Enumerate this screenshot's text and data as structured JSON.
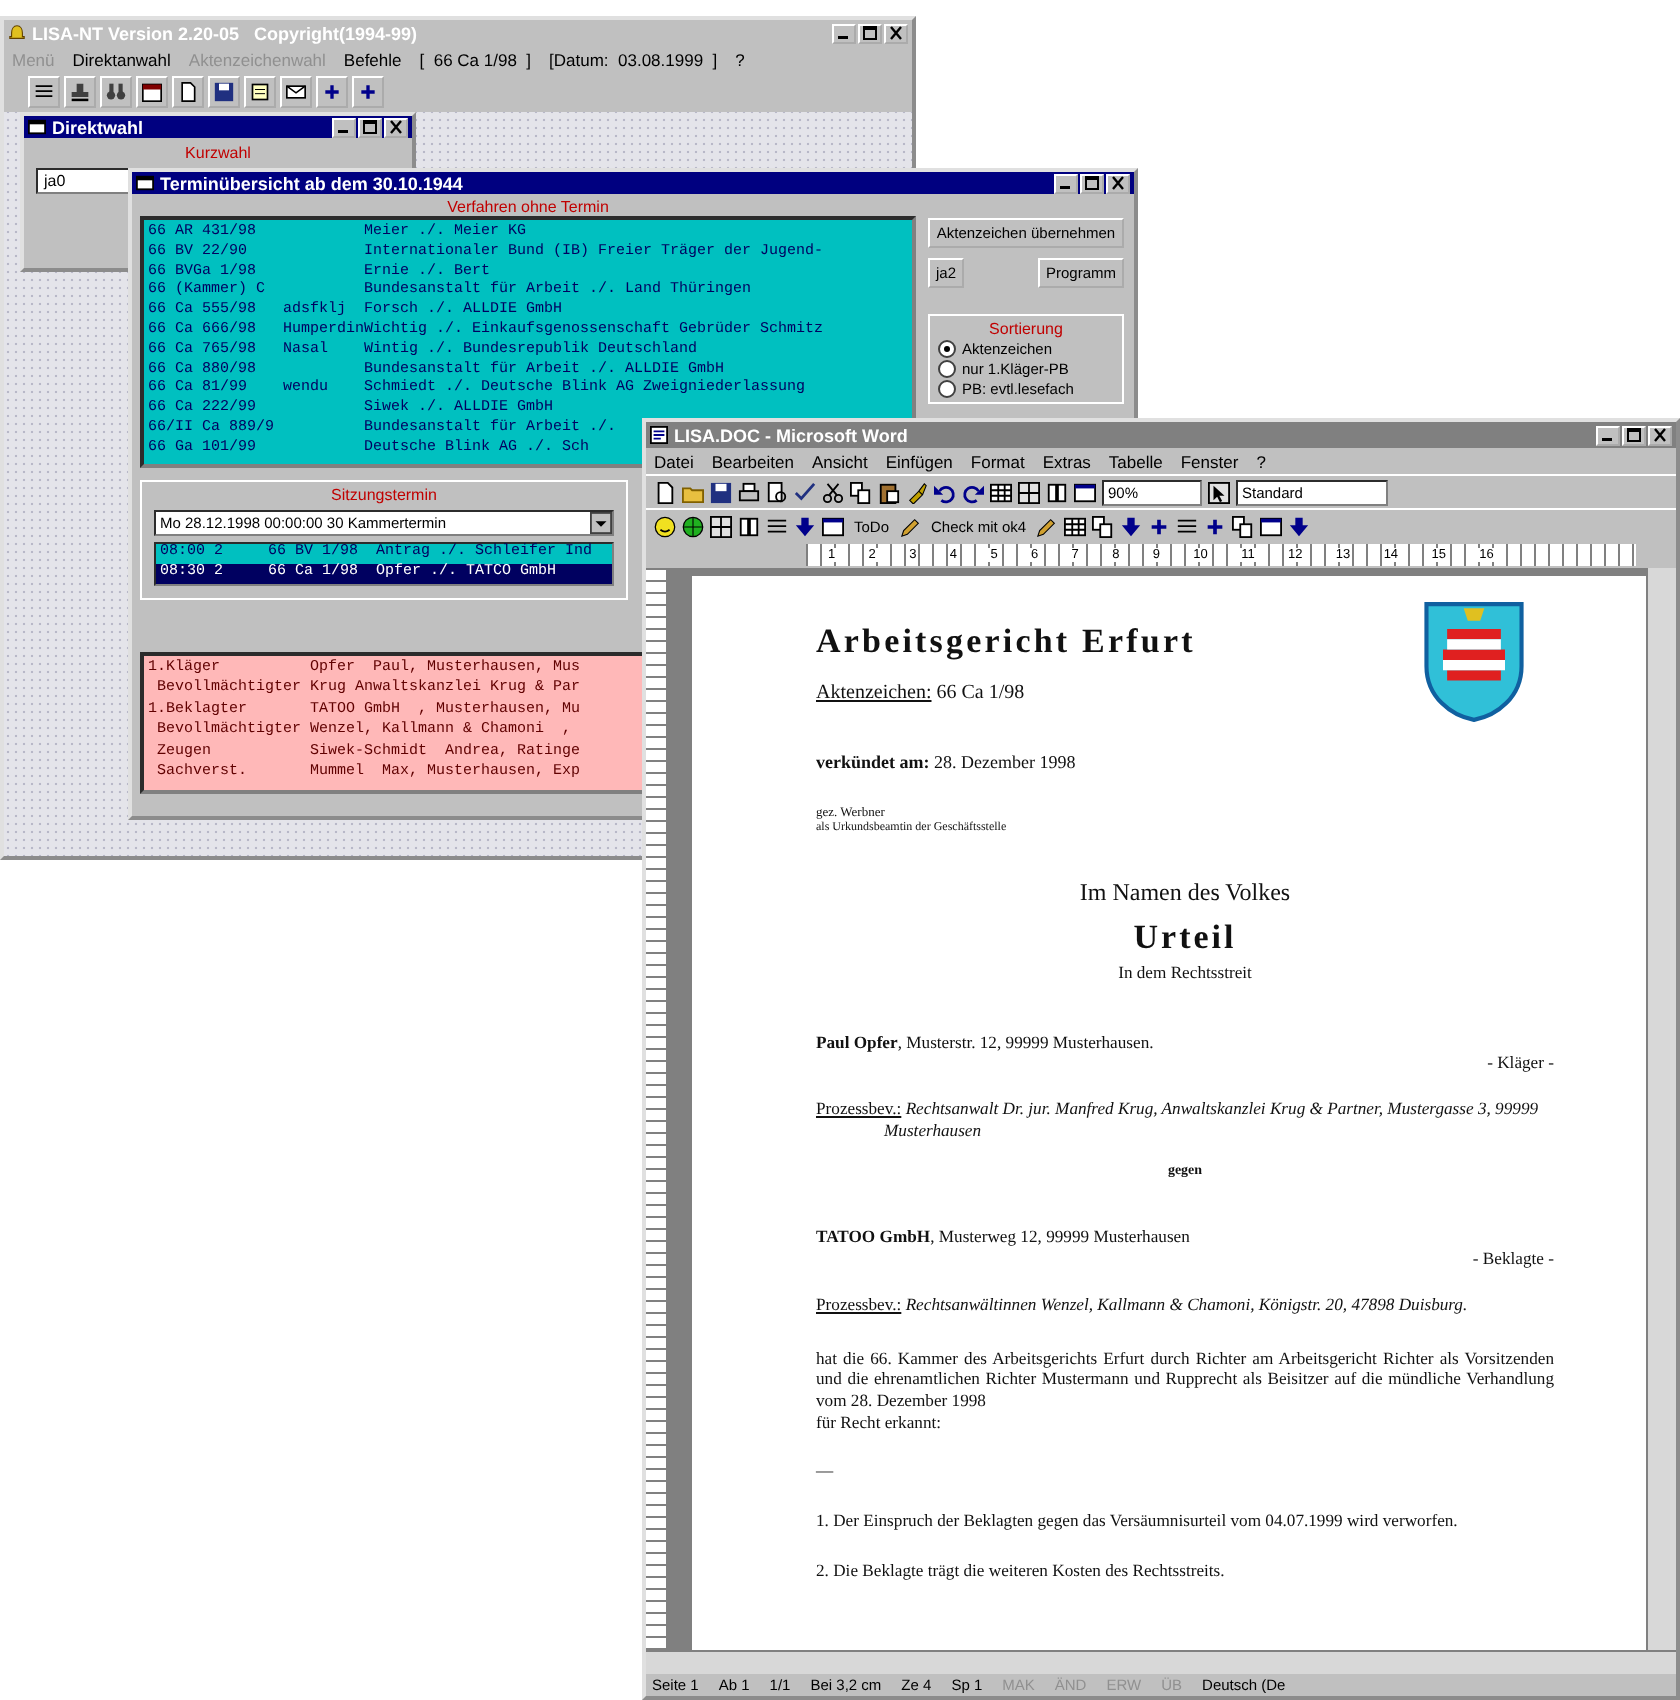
{
  "main_window": {
    "title": "LISA-NT Version 2.20-05   Copyright(1994-99)",
    "menu": [
      {
        "label": "Menü",
        "disabled": true
      },
      {
        "label": "Direktanwahl",
        "disabled": false
      },
      {
        "label": "Aktenzeichenwahl",
        "disabled": true
      },
      {
        "label": "Befehle",
        "disabled": false
      },
      {
        "label": "[  66 Ca 1/98  ]",
        "disabled": false
      },
      {
        "label": "[Datum:  03.08.1999  ]",
        "disabled": false
      },
      {
        "label": "?",
        "disabled": false
      }
    ]
  },
  "direktwahl_window": {
    "title": "Direktwahl",
    "group_label": "Kurzwahl",
    "field_value": "ja0"
  },
  "termin_window": {
    "title": "Terminübersicht ab dem 30.10.1944",
    "unscheduled_label": "Verfahren ohne Termin",
    "unscheduled_rows": [
      {
        "file": "66 AR 431/98",
        "note": "",
        "parties": "Meier ./. Meier KG"
      },
      {
        "file": "66 BV 22/90",
        "note": "",
        "parties": "Internationaler Bund (IB) Freier Träger der Jugend-"
      },
      {
        "file": "66 BVGa 1/98",
        "note": "",
        "parties": "Ernie ./. Bert"
      },
      {
        "file": "66 (Kammer) C",
        "note": "",
        "parties": "Bundesanstalt für Arbeit ./. Land Thüringen"
      },
      {
        "file": "66 Ca 555/98",
        "note": "adsfklj",
        "parties": "Forsch ./. ALLDIE GmbH"
      },
      {
        "file": "66 Ca 666/98",
        "note": "Humperdin",
        "parties": "Wichtig ./. Einkaufsgenossenschaft Gebrüder Schmitz"
      },
      {
        "file": "66 Ca 765/98",
        "note": "Nasal",
        "parties": "Wintig ./. Bundesrepublik Deutschland"
      },
      {
        "file": "66 Ca 880/98",
        "note": "",
        "parties": "Bundesanstalt für Arbeit ./. ALLDIE GmbH"
      },
      {
        "file": "66 Ca 81/99",
        "note": "wendu",
        "parties": "Schmiedt ./. Deutsche Blink AG Zweigniederlassung"
      },
      {
        "file": "66 Ca 222/99",
        "note": "",
        "parties": "Siwek ./. ALLDIE GmbH"
      },
      {
        "file": "66/II Ca 889/9",
        "note": "",
        "parties": "Bundesanstalt für Arbeit ./."
      },
      {
        "file": "66 Ga 101/99",
        "note": "",
        "parties": "Deutsche Blink AG ./. Sch"
      }
    ],
    "buttons": [
      "Aktenzeichen übernehmen",
      "ja2",
      "Programm"
    ],
    "sort_label": "Sortierung",
    "sort_options": [
      {
        "label": "Aktenzeichen",
        "selected": true
      },
      {
        "label": "nur 1.Kläger-PB",
        "selected": false
      },
      {
        "label": "PB: evtl.lesefach",
        "selected": false
      }
    ],
    "session_label": "Sitzungstermin",
    "session_select": "Mo 28.12.1998 00:00:00 30 Kammertermin",
    "sessions": [
      {
        "time": "08:00 2",
        "file": "66 BV 1/98",
        "parties": "Antrag ./. Schleifer Ind",
        "selected": false
      },
      {
        "time": "08:30 2",
        "file": "66 Ca 1/98",
        "parties": "Opfer ./. TATCO GmbH",
        "selected": true
      }
    ],
    "participants": [
      {
        "role": "1.Kläger",
        "details": "Opfer  Paul, Musterhausen, Mus"
      },
      {
        "role": " Bevollmächtigter",
        "details": "Krug Anwaltskanzlei Krug & Par"
      },
      {
        "role": "1.Beklagter",
        "details": "TATOO GmbH  , Musterhausen, Mu"
      },
      {
        "role": " Bevollmächtigter",
        "details": "Wenzel, Kallmann & Chamoni  ,"
      },
      {
        "role": " Zeugen",
        "details": "Siwek-Schmidt  Andrea, Ratinge"
      },
      {
        "role": " Sachverst.",
        "details": "Mummel  Max, Musterhausen, Exp"
      }
    ]
  },
  "word_window": {
    "title": "LISA.DOC - Microsoft Word",
    "menu": [
      "Datei",
      "Bearbeiten",
      "Ansicht",
      "Einfügen",
      "Format",
      "Extras",
      "Tabelle",
      "Fenster",
      "?"
    ],
    "zoom_value": "90%",
    "style_value": "Standard",
    "macro_buttons": [
      "ToDo",
      "Check mit ok4"
    ],
    "ruler_numbers": [
      "1",
      "2",
      "3",
      "4",
      "5",
      "6",
      "7",
      "8",
      "9",
      "10",
      "11",
      "12",
      "13",
      "14",
      "15",
      "16"
    ],
    "document": [
      {
        "kind": "title",
        "text": "Arbeitsgericht Erfurt"
      },
      {
        "kind": "ref",
        "label": "Aktenzeichen:",
        "text": "66 Ca 1/98"
      },
      {
        "kind": "date",
        "text": "**verkündet am:** 28. Dezember 1998"
      },
      {
        "kind": "signature",
        "text": "gez. Werbner"
      },
      {
        "kind": "small",
        "text": "als Urkundsbeamtin der Geschäftsstelle"
      },
      {
        "kind": "center",
        "text": "Im Namen des Volkes"
      },
      {
        "kind": "heading",
        "text": "Urteil"
      },
      {
        "kind": "subcenter",
        "text": "In dem Rechtsstreit"
      },
      {
        "kind": "party",
        "text": "**Paul Opfer**, Musterstr. 12, 99999 Musterhausen."
      },
      {
        "kind": "role",
        "text": "- Kläger -"
      },
      {
        "kind": "counsel",
        "label": "Prozessbev.:",
        "text": "Rechtsanwalt Dr. jur. Manfred Krug, Anwaltskanzlei Krug & Partner, Mustergasse 3, 99999 Musterhausen"
      },
      {
        "kind": "against",
        "text": "gegen"
      },
      {
        "kind": "party",
        "text": "**TATOO GmbH**, Musterweg 12, 99999 Musterhausen"
      },
      {
        "kind": "role",
        "text": "- Beklagte -"
      },
      {
        "kind": "counsel",
        "label": "Prozessbev.:",
        "text": "Rechtsanwältinnen Wenzel, Kallmann & Chamoni, Königstr. 20, 47898 Duisburg."
      },
      {
        "kind": "para",
        "text": "hat die 66. Kammer des Arbeitsgerichts Erfurt durch Richter am Arbeitsgericht Richter als Vorsitzenden und die ehrenamtlichen Richter Mustermann und Rupprecht als Beisitzer auf die mündliche Verhandlung vom 28. Dezember 1998"
      },
      {
        "kind": "plain",
        "text": "für Recht erkannt:"
      },
      {
        "kind": "rule",
        "text": "—"
      },
      {
        "kind": "item",
        "text": "1. Der Einspruch der Beklagten gegen das Versäumnisurteil vom 04.07.1999 wird verworfen."
      },
      {
        "kind": "item",
        "text": "2. Die Beklagte trägt die weiteren Kosten des Rechtsstreits."
      }
    ],
    "status": [
      {
        "label": "Seite 1",
        "disabled": false
      },
      {
        "label": "Ab 1",
        "disabled": false
      },
      {
        "label": "1/1",
        "disabled": false
      },
      {
        "label": "Bei 3,2 cm",
        "disabled": false
      },
      {
        "label": "Ze 4",
        "disabled": false
      },
      {
        "label": "Sp 1",
        "disabled": false
      },
      {
        "label": "MAK",
        "disabled": true
      },
      {
        "label": "ÄND",
        "disabled": true
      },
      {
        "label": "ERW",
        "disabled": true
      },
      {
        "label": "ÜB",
        "disabled": true
      },
      {
        "label": "Deutsch (De",
        "disabled": false
      }
    ]
  }
}
